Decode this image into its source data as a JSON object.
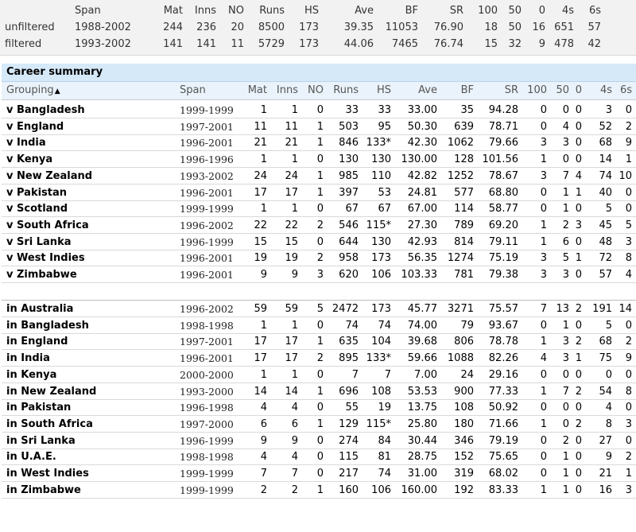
{
  "top_summary": {
    "headers": [
      "Span",
      "Mat",
      "Inns",
      "NO",
      "Runs",
      "HS",
      "Ave",
      "BF",
      "SR",
      "100",
      "50",
      "0",
      "4s",
      "6s"
    ],
    "rows": [
      {
        "label": "unfiltered",
        "values": [
          "1988-2002",
          "244",
          "236",
          "20",
          "8500",
          "173",
          "39.35",
          "11053",
          "76.90",
          "18",
          "50",
          "16",
          "651",
          "57"
        ]
      },
      {
        "label": "filtered",
        "values": [
          "1993-2002",
          "141",
          "141",
          "11",
          "5729",
          "173",
          "44.06",
          "7465",
          "76.74",
          "15",
          "32",
          "9",
          "478",
          "42"
        ]
      }
    ]
  },
  "career": {
    "title": "Career summary",
    "headers": [
      "Grouping",
      "Span",
      "Mat",
      "Inns",
      "NO",
      "Runs",
      "HS",
      "Ave",
      "BF",
      "SR",
      "100",
      "50",
      "0",
      "4s",
      "6s"
    ],
    "sort_indicator": "▲",
    "versus_rows": [
      [
        "v Bangladesh",
        "1999-1999",
        "1",
        "1",
        "0",
        "33",
        "33",
        "33.00",
        "35",
        "94.28",
        "0",
        "0",
        "0",
        "3",
        "0"
      ],
      [
        "v England",
        "1997-2001",
        "11",
        "11",
        "1",
        "503",
        "95",
        "50.30",
        "639",
        "78.71",
        "0",
        "4",
        "0",
        "52",
        "2"
      ],
      [
        "v India",
        "1996-2001",
        "21",
        "21",
        "1",
        "846",
        "133*",
        "42.30",
        "1062",
        "79.66",
        "3",
        "3",
        "0",
        "68",
        "9"
      ],
      [
        "v Kenya",
        "1996-1996",
        "1",
        "1",
        "0",
        "130",
        "130",
        "130.00",
        "128",
        "101.56",
        "1",
        "0",
        "0",
        "14",
        "1"
      ],
      [
        "v New Zealand",
        "1993-2002",
        "24",
        "24",
        "1",
        "985",
        "110",
        "42.82",
        "1252",
        "78.67",
        "3",
        "7",
        "4",
        "74",
        "10"
      ],
      [
        "v Pakistan",
        "1996-2001",
        "17",
        "17",
        "1",
        "397",
        "53",
        "24.81",
        "577",
        "68.80",
        "0",
        "1",
        "1",
        "40",
        "0"
      ],
      [
        "v Scotland",
        "1999-1999",
        "1",
        "1",
        "0",
        "67",
        "67",
        "67.00",
        "114",
        "58.77",
        "0",
        "1",
        "0",
        "5",
        "0"
      ],
      [
        "v South Africa",
        "1996-2002",
        "22",
        "22",
        "2",
        "546",
        "115*",
        "27.30",
        "789",
        "69.20",
        "1",
        "2",
        "3",
        "45",
        "5"
      ],
      [
        "v Sri Lanka",
        "1996-1999",
        "15",
        "15",
        "0",
        "644",
        "130",
        "42.93",
        "814",
        "79.11",
        "1",
        "6",
        "0",
        "48",
        "3"
      ],
      [
        "v West Indies",
        "1996-2001",
        "19",
        "19",
        "2",
        "958",
        "173",
        "56.35",
        "1274",
        "75.19",
        "3",
        "5",
        "1",
        "72",
        "8"
      ],
      [
        "v Zimbabwe",
        "1996-2001",
        "9",
        "9",
        "3",
        "620",
        "106",
        "103.33",
        "781",
        "79.38",
        "3",
        "3",
        "0",
        "57",
        "4"
      ]
    ],
    "location_rows": [
      [
        "in Australia",
        "1996-2002",
        "59",
        "59",
        "5",
        "2472",
        "173",
        "45.77",
        "3271",
        "75.57",
        "7",
        "13",
        "2",
        "191",
        "14"
      ],
      [
        "in Bangladesh",
        "1998-1998",
        "1",
        "1",
        "0",
        "74",
        "74",
        "74.00",
        "79",
        "93.67",
        "0",
        "1",
        "0",
        "5",
        "0"
      ],
      [
        "in England",
        "1997-2001",
        "17",
        "17",
        "1",
        "635",
        "104",
        "39.68",
        "806",
        "78.78",
        "1",
        "3",
        "2",
        "68",
        "2"
      ],
      [
        "in India",
        "1996-2001",
        "17",
        "17",
        "2",
        "895",
        "133*",
        "59.66",
        "1088",
        "82.26",
        "4",
        "3",
        "1",
        "75",
        "9"
      ],
      [
        "in Kenya",
        "2000-2000",
        "1",
        "1",
        "0",
        "7",
        "7",
        "7.00",
        "24",
        "29.16",
        "0",
        "0",
        "0",
        "0",
        "0"
      ],
      [
        "in New Zealand",
        "1993-2000",
        "14",
        "14",
        "1",
        "696",
        "108",
        "53.53",
        "900",
        "77.33",
        "1",
        "7",
        "2",
        "54",
        "8"
      ],
      [
        "in Pakistan",
        "1996-1998",
        "4",
        "4",
        "0",
        "55",
        "19",
        "13.75",
        "108",
        "50.92",
        "0",
        "0",
        "0",
        "4",
        "0"
      ],
      [
        "in South Africa",
        "1997-2000",
        "6",
        "6",
        "1",
        "129",
        "115*",
        "25.80",
        "180",
        "71.66",
        "1",
        "0",
        "2",
        "8",
        "3"
      ],
      [
        "in Sri Lanka",
        "1996-1999",
        "9",
        "9",
        "0",
        "274",
        "84",
        "30.44",
        "346",
        "79.19",
        "0",
        "2",
        "0",
        "27",
        "0"
      ],
      [
        "in U.A.E.",
        "1998-1998",
        "4",
        "4",
        "0",
        "115",
        "81",
        "28.75",
        "152",
        "75.65",
        "0",
        "1",
        "0",
        "9",
        "2"
      ],
      [
        "in West Indies",
        "1999-1999",
        "7",
        "7",
        "0",
        "217",
        "74",
        "31.00",
        "319",
        "68.02",
        "0",
        "1",
        "0",
        "21",
        "1"
      ],
      [
        "in Zimbabwe",
        "1999-1999",
        "2",
        "2",
        "1",
        "160",
        "106",
        "160.00",
        "192",
        "83.33",
        "1",
        "1",
        "0",
        "16",
        "3"
      ]
    ]
  }
}
